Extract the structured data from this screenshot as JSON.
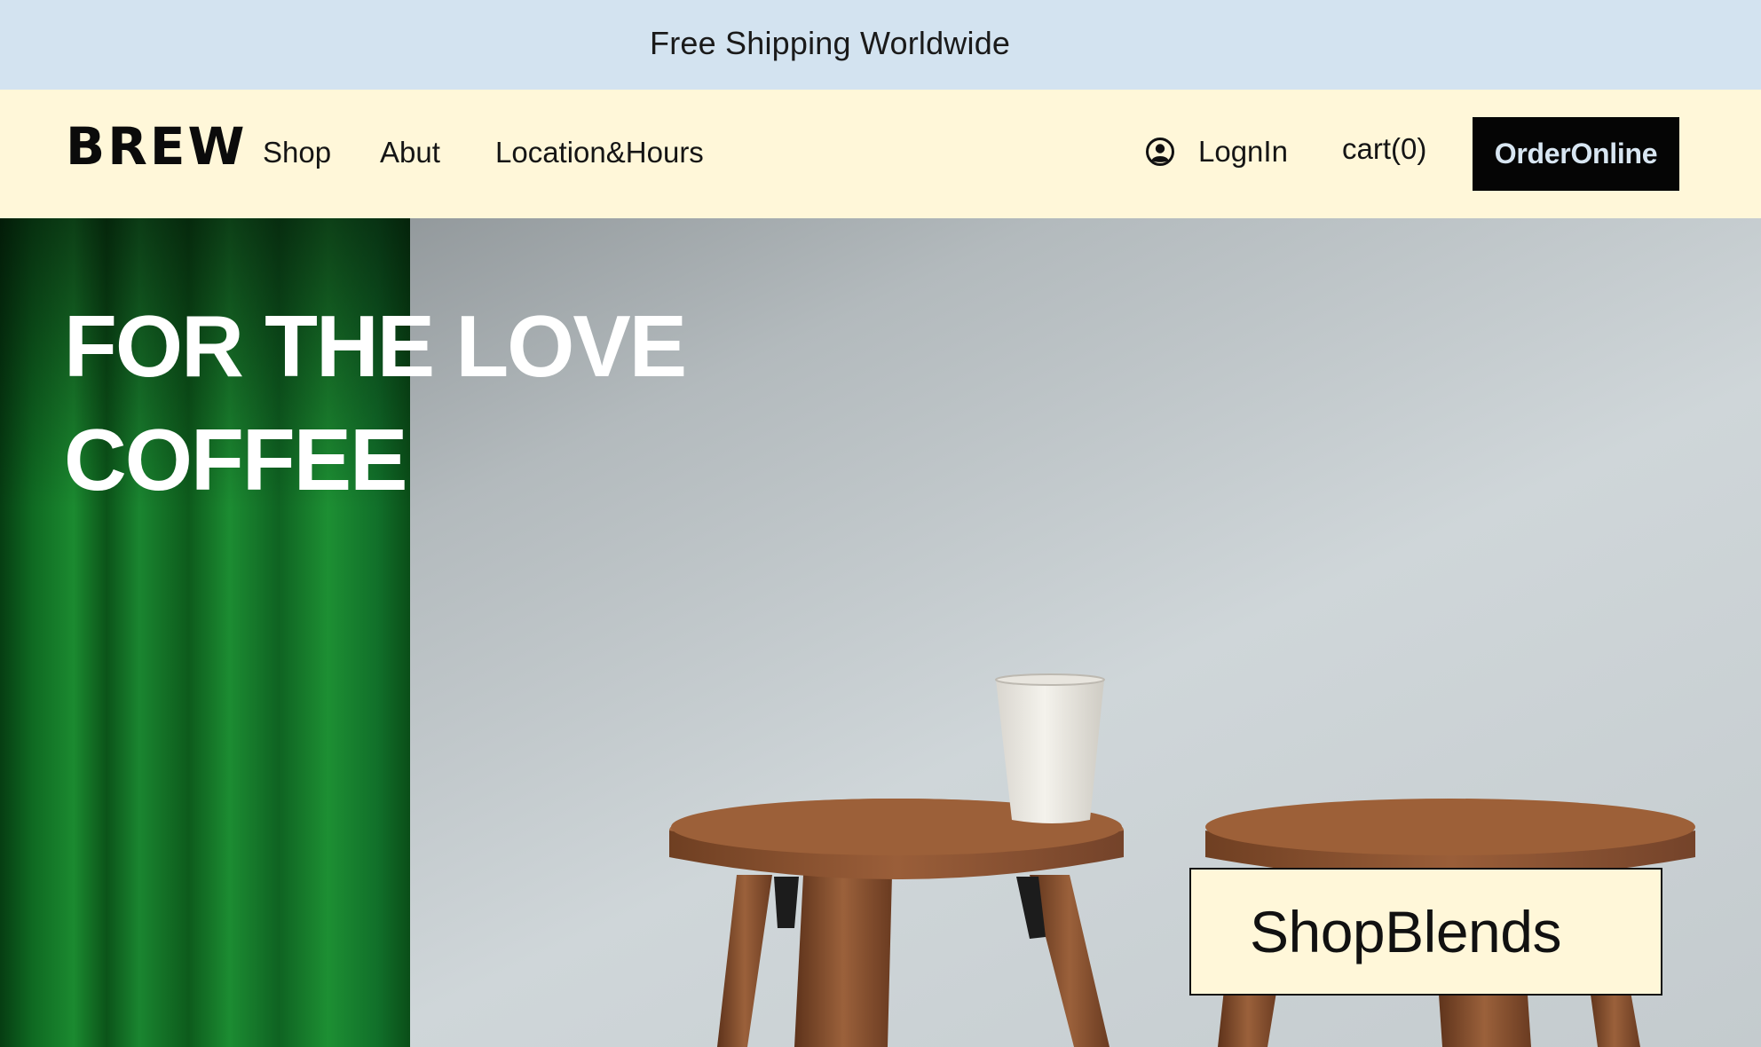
{
  "announcement": {
    "text": "Free Shipping Worldwide"
  },
  "header": {
    "logo": "BREW",
    "nav": [
      {
        "label": "Shop"
      },
      {
        "label": "Abut"
      },
      {
        "label": "Location&Hours"
      }
    ],
    "login_label": "LognIn",
    "login_icon": "user-circle-icon",
    "cart_label": "cart(0)",
    "order_button_label": "OrderOnline"
  },
  "hero": {
    "title_line1": "FOR THE LOVE",
    "title_line2": "COFFEE",
    "cta_label": "ShopBlends"
  },
  "colors": {
    "announcement_bg": "#d3e3f0",
    "header_bg": "#fff7d9",
    "order_button_bg": "#050505",
    "order_button_text": "#d8e6f2",
    "curtain_green": "#1a7a2a",
    "wood_brown": "#8a5232",
    "wall_gray": "#cfd6d9"
  }
}
